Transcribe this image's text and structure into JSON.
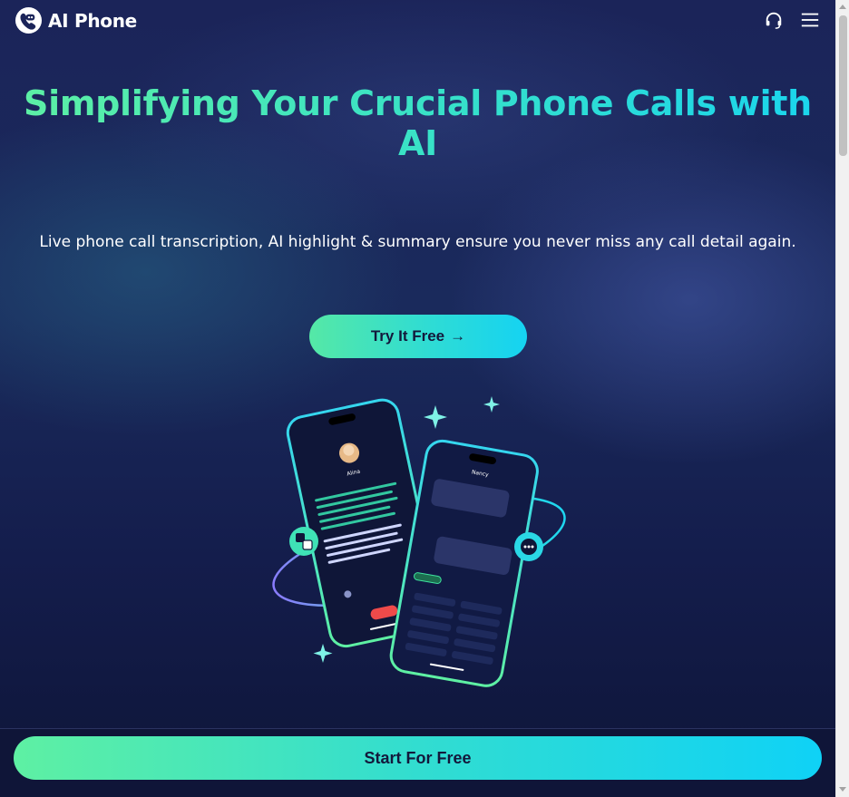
{
  "header": {
    "brand": "AI Phone",
    "icons": {
      "logo": "ai-phone-logo-icon",
      "support": "headset-icon",
      "menu": "hamburger-menu-icon"
    }
  },
  "hero": {
    "title": "Simplifying Your Crucial Phone Calls with AI",
    "subtitle": "Live phone call transcription, AI highlight & summary ensure you never miss any call detail again.",
    "cta_label": "Try It Free",
    "cta_arrow": "→"
  },
  "illustration": {
    "left_phone": {
      "caller_name": "Alina"
    },
    "right_phone": {
      "contact_name": "Nancy"
    }
  },
  "bottom_bar": {
    "cta_label": "Start For Free"
  },
  "colors": {
    "accent_start": "#5ef0a3",
    "accent_end": "#0fd2f6",
    "background": "#1b2459",
    "text_dark": "#13183b"
  }
}
